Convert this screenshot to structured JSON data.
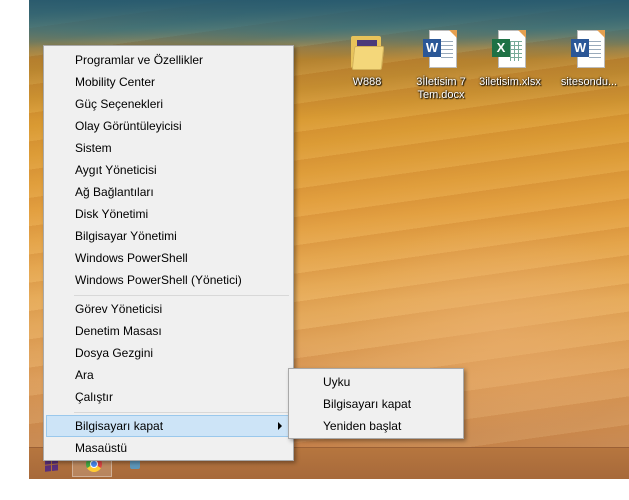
{
  "desktop": {
    "icons": [
      {
        "label": "W888",
        "type": "folder"
      },
      {
        "label": "3İletisim 7 Tem.docx",
        "label_line1": "3İletisim 7",
        "label_line2": "Tem.docx",
        "type": "word",
        "badge": "W"
      },
      {
        "label": "3iletisim.xlsx",
        "type": "excel",
        "badge": "X"
      },
      {
        "label": "sitesondu...",
        "type": "word",
        "badge": "W"
      }
    ]
  },
  "menu": {
    "group1": [
      {
        "label": "Programlar ve Özellikler"
      },
      {
        "label": "Mobility Center"
      },
      {
        "label": "Güç Seçenekleri"
      },
      {
        "label": "Olay Görüntüleyicisi"
      },
      {
        "label": "Sistem"
      },
      {
        "label": "Aygıt Yöneticisi"
      },
      {
        "label": "Ağ Bağlantıları"
      },
      {
        "label": "Disk Yönetimi"
      },
      {
        "label": "Bilgisayar Yönetimi"
      },
      {
        "label": "Windows PowerShell"
      },
      {
        "label": "Windows PowerShell (Yönetici)"
      }
    ],
    "group2": [
      {
        "label": "Görev Yöneticisi"
      },
      {
        "label": "Denetim Masası"
      },
      {
        "label": "Dosya Gezgini"
      },
      {
        "label": "Ara"
      },
      {
        "label": "Çalıştır"
      }
    ],
    "shutdown": {
      "label": "Bilgisayarı kapat",
      "highlighted": true,
      "has_submenu": true
    },
    "desktop_item": {
      "label": "Masaüstü"
    }
  },
  "submenu": {
    "items": [
      {
        "label": "Uyku"
      },
      {
        "label": "Bilgisayarı kapat"
      },
      {
        "label": "Yeniden başlat"
      }
    ]
  },
  "colors": {
    "menu_bg": "#f0f0f0",
    "highlight_bg": "#cde4f7",
    "highlight_border": "#9ac8ec",
    "taskbar": "#b6763f",
    "word_badge": "#2b5797",
    "excel_badge": "#1e7145"
  },
  "taskbar": {
    "items": [
      {
        "icon": "windows-start-icon"
      },
      {
        "icon": "chrome-icon"
      },
      {
        "icon": "app-icon"
      }
    ]
  }
}
